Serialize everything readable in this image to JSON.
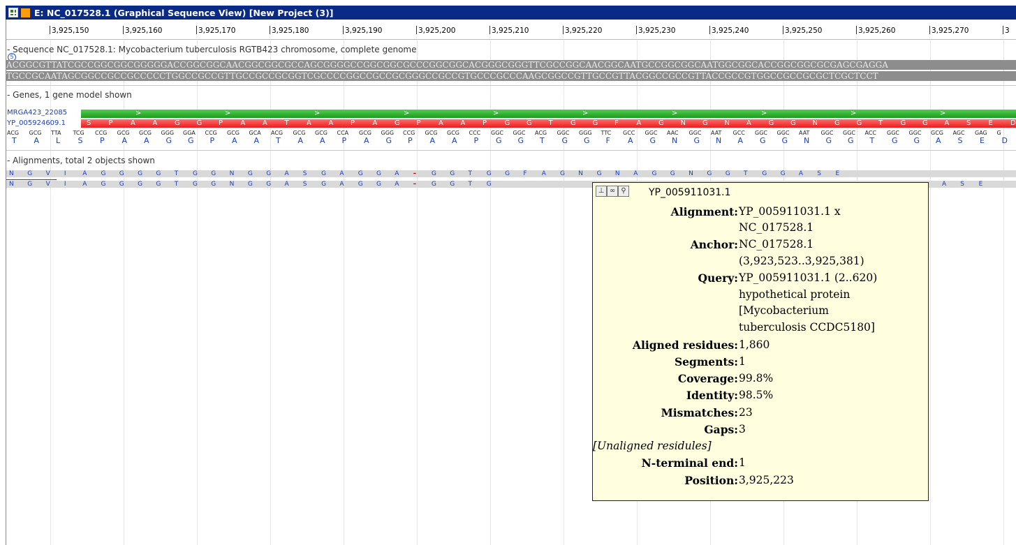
{
  "window": {
    "title": "E: NC_017528.1 (Graphical Sequence View) [New Project (3)]"
  },
  "ruler": {
    "ticks": [
      "3,925,150",
      "3,925,160",
      "3,925,170",
      "3,925,180",
      "3,925,190",
      "3,925,200",
      "3,925,210",
      "3,925,220",
      "3,925,230",
      "3,925,240",
      "3,925,250",
      "3,925,260",
      "3,925,270",
      "3"
    ]
  },
  "sequence": {
    "title": "Sequence NC_017528.1: Mycobacterium tuberculosis RGTB423 chromosome, complete genome",
    "forward": "ACGGCGTTATCGCCGGCGGCGGGGGACCGGCGGCAACGGCGGCGCCAGCGGGGCCGGCGGCGCCCGGCGGCACGGGCGGGTTCGCCGGCAACGGCAATGCCGGCGGCAATGGCGGCACCGGCGGCGCGAGCGAGGA",
    "reverse": "TGCCGCAATAGCGGCCGCCGCCCCCTGGCCGCCGTTGCCGCCGCGGTCGCCCCGGCCGCCGCGGGCCGCCGTGCCCGCCCAAGCGGCCGTTGCCGTTACGGCCGCCGTTACCGCCGTGGCCGCCGCGCTCGCTCCT"
  },
  "genes": {
    "title": "Genes, 1 gene model shown",
    "gene_label": "MRGA423_22085",
    "protein_label": "YP_005924609.1",
    "protein_aas": [
      "S",
      "P",
      "A",
      "A",
      "G",
      "G",
      "P",
      "A",
      "A",
      "T",
      "A",
      "A",
      "P",
      "A",
      "G",
      "P",
      "A",
      "A",
      "P",
      "G",
      "G",
      "T",
      "G",
      "G",
      "F",
      "A",
      "G",
      "N",
      "G",
      "N",
      "A",
      "G",
      "G",
      "N",
      "G",
      "G",
      "T",
      "G",
      "G",
      "A",
      "S",
      "E",
      "D"
    ],
    "codons": [
      "ACG",
      "GCG",
      "TTA",
      "TCG",
      "CCG",
      "GCG",
      "GCG",
      "GGG",
      "GGA",
      "CCG",
      "GCG",
      "GCA",
      "ACG",
      "GCG",
      "GCG",
      "CCA",
      "GCG",
      "GGG",
      "CCG",
      "GCG",
      "GCG",
      "CCC",
      "GGC",
      "GGC",
      "ACG",
      "GGC",
      "GGG",
      "TTC",
      "GCC",
      "GGC",
      "AAC",
      "GGC",
      "AAT",
      "GCC",
      "GGC",
      "GGC",
      "AAT",
      "GGC",
      "GGC",
      "ACC",
      "GGC",
      "GGC",
      "GCG",
      "AGC",
      "GAG",
      "G"
    ],
    "translation": [
      "T",
      "A",
      "L",
      "S",
      "P",
      "A",
      "A",
      "G",
      "G",
      "P",
      "A",
      "A",
      "T",
      "A",
      "A",
      "P",
      "A",
      "G",
      "P",
      "A",
      "A",
      "P",
      "G",
      "G",
      "T",
      "G",
      "G",
      "F",
      "A",
      "G",
      "N",
      "G",
      "N",
      "A",
      "G",
      "G",
      "N",
      "G",
      "G",
      "T",
      "G",
      "G",
      "A",
      "S",
      "E",
      "D"
    ]
  },
  "alignments": {
    "title": "Alignments, total 2 objects shown",
    "row1": [
      "N",
      "G",
      "V",
      "I",
      "A",
      "G",
      "G",
      "G",
      "G",
      "T",
      "G",
      "G",
      "N",
      "G",
      "G",
      "A",
      "S",
      "G",
      "A",
      "G",
      "G",
      "A",
      "–",
      "G",
      "G",
      "T",
      "G",
      "G",
      "F",
      "A",
      "G",
      "N",
      "G",
      "N",
      "A",
      "G",
      "G",
      "N",
      "G",
      "G",
      "T",
      "G",
      "G",
      "A",
      "S",
      "E"
    ],
    "row2": [
      "N",
      "G",
      "V",
      "I",
      "A",
      "G",
      "G",
      "G",
      "G",
      "T",
      "G",
      "G",
      "N",
      "G",
      "G",
      "A",
      "S",
      "G",
      "A",
      "G",
      "G",
      "A",
      "–",
      "G",
      "G",
      "T",
      "G",
      "A",
      "S",
      "E"
    ]
  },
  "tooltip": {
    "header": "YP_005911031.1",
    "alignment_key": "Alignment:",
    "alignment_val1": "YP_005911031.1 x",
    "alignment_val2": "NC_017528.1",
    "anchor_key": "Anchor:",
    "anchor_val1": "NC_017528.1",
    "anchor_val2": "(3,923,523..3,925,381)",
    "query_key": "Query:",
    "query_val1": "YP_005911031.1 (2..620)",
    "query_val2": "hypothetical protein",
    "query_val3": "[Mycobacterium",
    "query_val4": "tuberculosis CCDC5180]",
    "aligned_key": "Aligned residues:",
    "aligned_val": "1,860",
    "segments_key": "Segments:",
    "segments_val": "1",
    "coverage_key": "Coverage:",
    "coverage_val": "99.8%",
    "identity_key": "Identity:",
    "identity_val": "98.5%",
    "mismatches_key": "Mismatches:",
    "mismatches_val": "23",
    "gaps_key": "Gaps:",
    "gaps_val": "3",
    "unaligned_label": "[Unaligned residules]",
    "nterm_key": "N-terminal end:",
    "nterm_val": "1",
    "position_key": "Position:",
    "position_val": "3,925,223",
    "tools": [
      "pin-icon",
      "binoculars-icon",
      "zoom-icon"
    ]
  },
  "colors": {
    "titlebar": "#0a2a88",
    "gene": "#2eb82e",
    "protein": "#f03c3c",
    "aa_text": "#1b3fb5",
    "tooltip_bg": "#ffffdf"
  }
}
